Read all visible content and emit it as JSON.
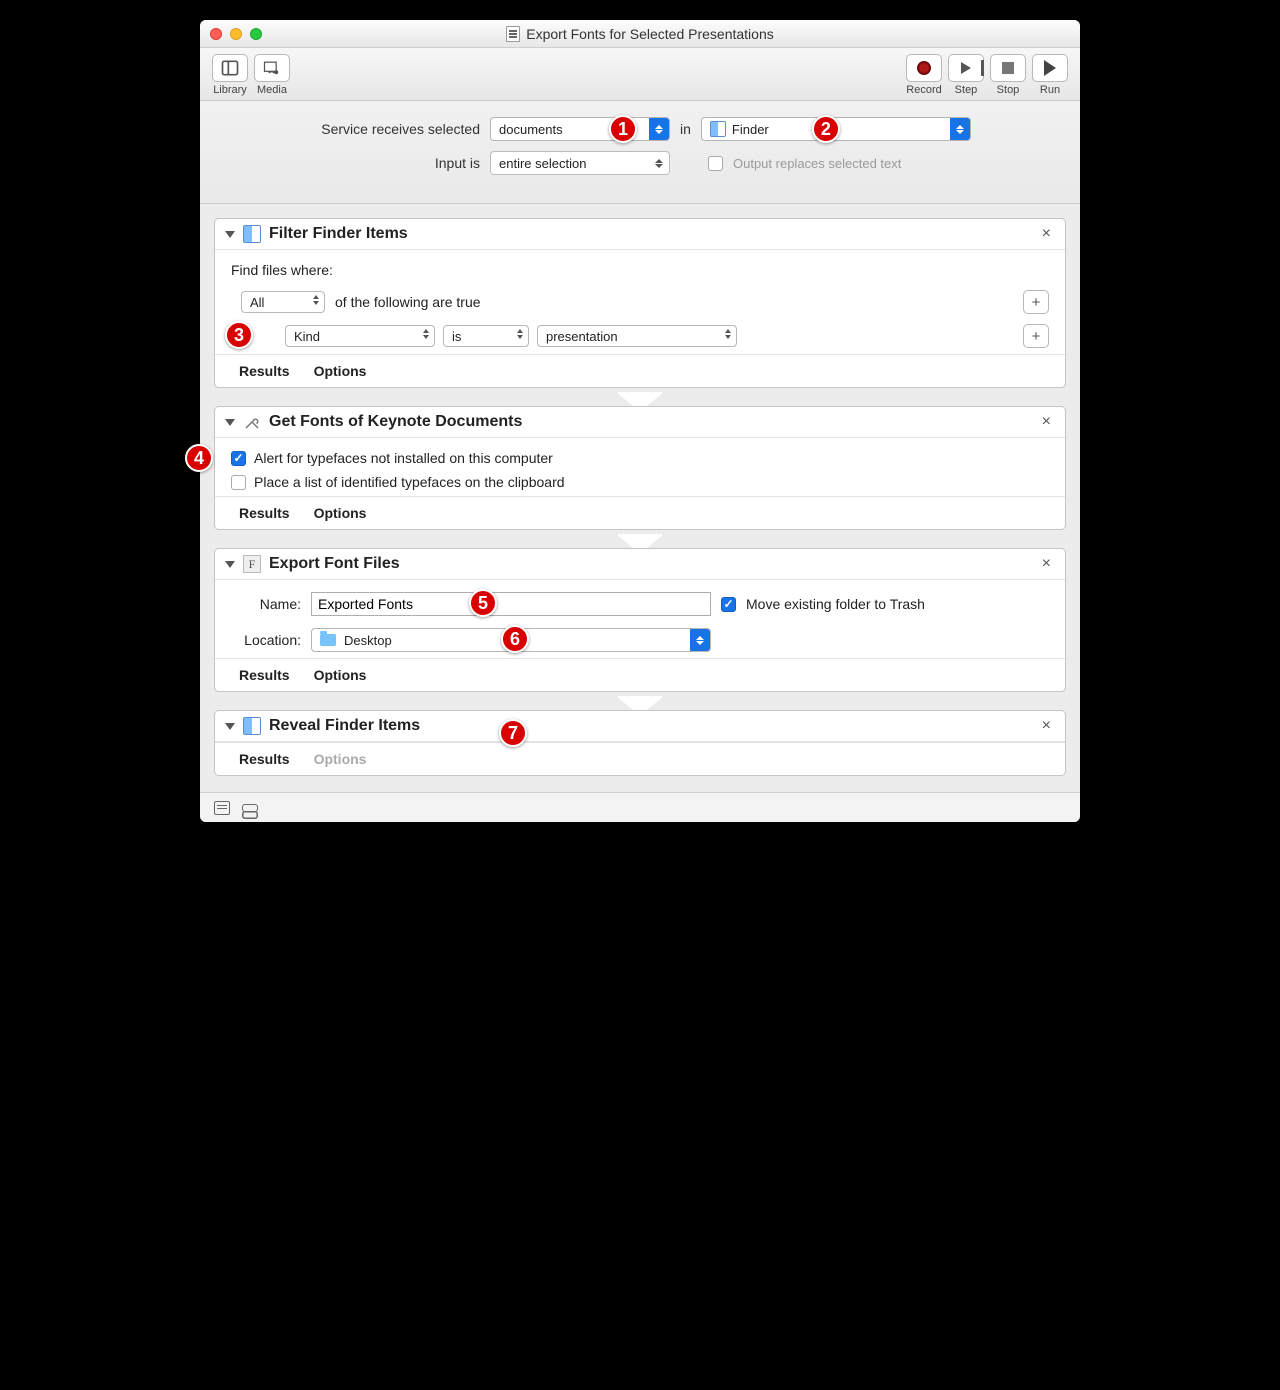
{
  "window": {
    "title": "Export Fonts for Selected Presentations"
  },
  "toolbar": {
    "library": "Library",
    "media": "Media",
    "record": "Record",
    "step": "Step",
    "stop": "Stop",
    "run": "Run"
  },
  "config": {
    "receives_label": "Service receives selected",
    "receives_value": "documents",
    "in_label": "in",
    "app_value": "Finder",
    "input_is_label": "Input is",
    "input_is_value": "entire selection",
    "output_replaces": "Output replaces selected text"
  },
  "actions": {
    "filter": {
      "title": "Filter Finder Items",
      "find_label": "Find files where:",
      "match_value": "All",
      "match_suffix": "of the following are true",
      "cond_attr": "Kind",
      "cond_op": "is",
      "cond_val": "presentation",
      "results": "Results",
      "options": "Options"
    },
    "getfonts": {
      "title": "Get Fonts of Keynote Documents",
      "opt1": "Alert for typefaces not installed on this computer",
      "opt2": "Place a list of identified typefaces on the clipboard",
      "results": "Results",
      "options": "Options"
    },
    "export": {
      "title": "Export Font Files",
      "name_label": "Name:",
      "name_value": "Exported Fonts",
      "move_trash": "Move existing folder to Trash",
      "location_label": "Location:",
      "location_value": "Desktop",
      "results": "Results",
      "options": "Options"
    },
    "reveal": {
      "title": "Reveal Finder Items",
      "results": "Results",
      "options": "Options"
    }
  },
  "badges": [
    "1",
    "2",
    "3",
    "4",
    "5",
    "6",
    "7"
  ]
}
